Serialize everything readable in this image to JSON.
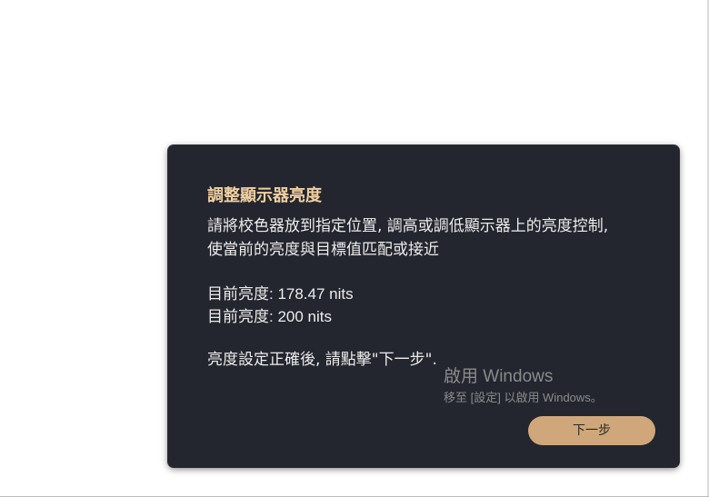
{
  "dialog": {
    "title": "調整顯示器亮度",
    "description_line1": "請將校色器放到指定位置, 調高或調低顯示器上的亮度控制,",
    "description_line2": "使當前的亮度與目標值匹配或接近",
    "current_brightness": "目前亮度: 178.47 nits",
    "target_brightness": "目前亮度: 200 nits",
    "hint": "亮度設定正確後, 請點擊\"下一步\".",
    "next_label": "下一步"
  },
  "watermark": {
    "title": "啟用 Windows",
    "subtitle": "移至 [設定] 以啟用 Windows。"
  },
  "colors": {
    "dialog_background": "#23262e",
    "title_accent": "#f0cfa0",
    "button_background": "#cfa77a"
  }
}
